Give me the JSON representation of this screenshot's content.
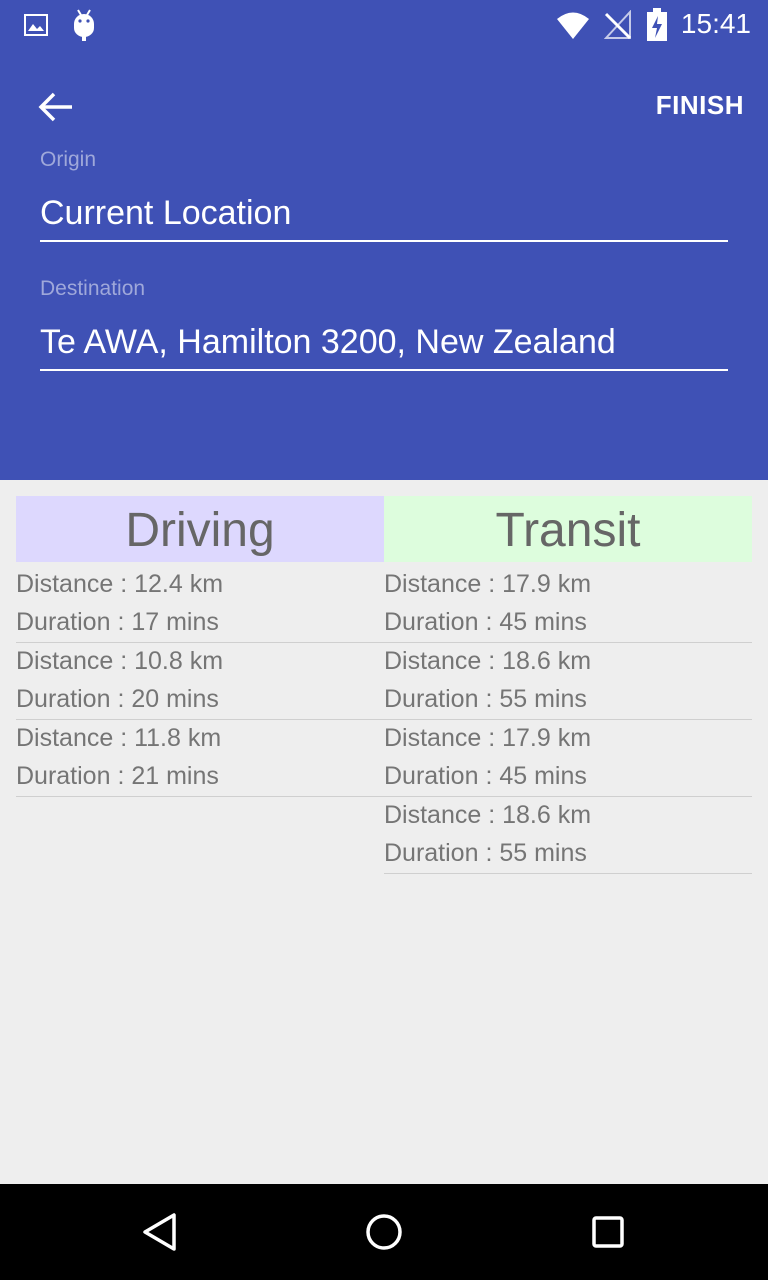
{
  "status_bar": {
    "time": "15:41",
    "icons": [
      "image-icon",
      "android-icon",
      "wifi-icon",
      "no-signal-icon",
      "battery-charging-icon"
    ]
  },
  "toolbar": {
    "back_icon": "arrow-back-icon",
    "finish_label": "FINISH"
  },
  "origin": {
    "label": "Origin",
    "value": "Current Location"
  },
  "destination": {
    "label": "Destination",
    "value": "Te AWA, Hamilton 3200, New Zealand"
  },
  "driving": {
    "title": "Driving",
    "color": "#ddd8fe",
    "routes": [
      {
        "distance": "Distance : 12.4 km",
        "duration": "Duration : 17 mins"
      },
      {
        "distance": "Distance : 10.8 km",
        "duration": "Duration : 20 mins"
      },
      {
        "distance": "Distance : 11.8 km",
        "duration": "Duration : 21 mins"
      }
    ]
  },
  "transit": {
    "title": "Transit",
    "color": "#ddfddd",
    "routes": [
      {
        "distance": "Distance : 17.9 km",
        "duration": "Duration : 45 mins"
      },
      {
        "distance": "Distance : 18.6 km",
        "duration": "Duration : 55 mins"
      },
      {
        "distance": "Distance : 17.9 km",
        "duration": "Duration : 45 mins"
      },
      {
        "distance": "Distance : 18.6 km",
        "duration": "Duration : 55 mins"
      }
    ]
  },
  "nav_bar": {
    "icons": [
      "back-triangle-icon",
      "home-circle-icon",
      "recents-square-icon"
    ]
  }
}
